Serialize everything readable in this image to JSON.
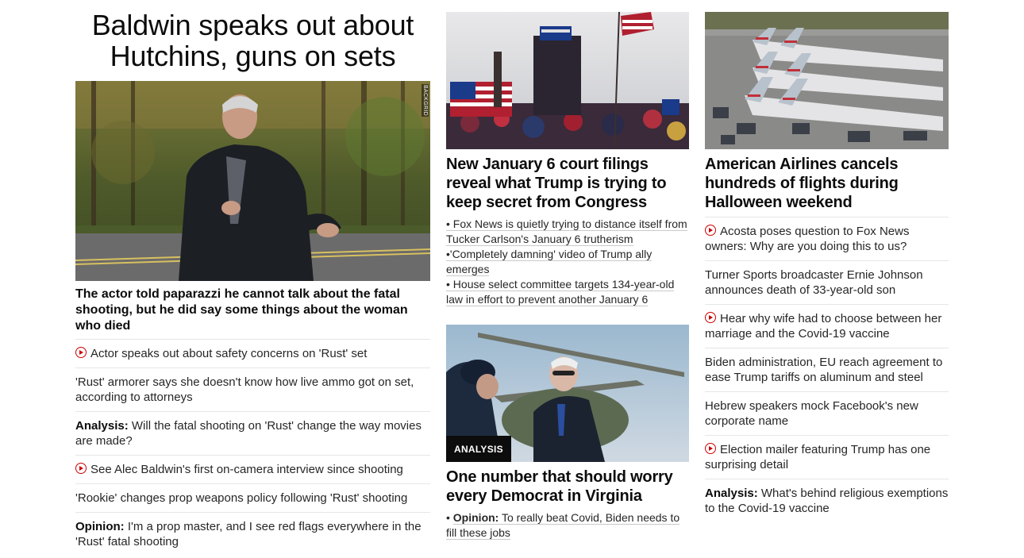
{
  "lead": {
    "headline": "Baldwin speaks out about Hutchins, guns on sets",
    "image_credit": "BACKGRID",
    "subhead": "The actor told paparazzi he cannot talk about the fatal shooting, but he did say some things about the woman who died",
    "items": [
      {
        "video": true,
        "prefix": "",
        "text": "Actor speaks out about safety concerns on 'Rust' set"
      },
      {
        "video": false,
        "prefix": "",
        "text": "'Rust' armorer says she doesn't know how live ammo got on set, according to attorneys"
      },
      {
        "video": false,
        "prefix": "Analysis:",
        "text": "Will the fatal shooting on 'Rust' change the way movies are made?"
      },
      {
        "video": true,
        "prefix": "",
        "text": "See Alec Baldwin's first on-camera interview since shooting"
      },
      {
        "video": false,
        "prefix": "",
        "text": "'Rookie' changes prop weapons policy following 'Rust' shooting"
      },
      {
        "video": false,
        "prefix": "Opinion:",
        "text": "I'm a prop master, and I see red flags everywhere in the 'Rust' fatal shooting"
      }
    ]
  },
  "middle": {
    "story1": {
      "headline": "New January 6 court filings reveal what Trump is trying to keep secret from Congress",
      "bullets": [
        "• Fox News is quietly trying to distance itself from Tucker Carlson's January 6 trutherism",
        "•'Completely damning' video of Trump ally emerges",
        "• House select committee targets 134-year-old law in effort to prevent another January 6"
      ]
    },
    "story2": {
      "badge": "ANALYSIS",
      "headline": "One number that should worry every Democrat in Virginia",
      "bullet_marker": "•",
      "bullet_prefix": "Opinion:",
      "bullet_text": "To really beat Covid, Biden needs to fill these jobs"
    }
  },
  "right": {
    "headline": "American Airlines cancels hundreds of flights during Halloween weekend",
    "items": [
      {
        "video": true,
        "prefix": "",
        "text": "Acosta poses question to Fox News owners: Why are you doing this to us?"
      },
      {
        "video": false,
        "prefix": "",
        "text": "Turner Sports broadcaster Ernie Johnson announces death of 33-year-old son"
      },
      {
        "video": true,
        "prefix": "",
        "text": "Hear why wife had to choose between her marriage and the Covid-19 vaccine"
      },
      {
        "video": false,
        "prefix": "",
        "text": "Biden administration, EU reach agreement to ease Trump tariffs on aluminum and steel"
      },
      {
        "video": false,
        "prefix": "",
        "text": "Hebrew speakers mock Facebook's new corporate name"
      },
      {
        "video": true,
        "prefix": "",
        "text": "Election mailer featuring Trump has one surprising detail"
      },
      {
        "video": false,
        "prefix": "Analysis:",
        "text": "What's behind religious exemptions to the Covid-19 vaccine"
      }
    ]
  },
  "colors": {
    "video_icon": "#cc0000",
    "divider": "#e6e6e6",
    "text": "#0c0c0c"
  }
}
